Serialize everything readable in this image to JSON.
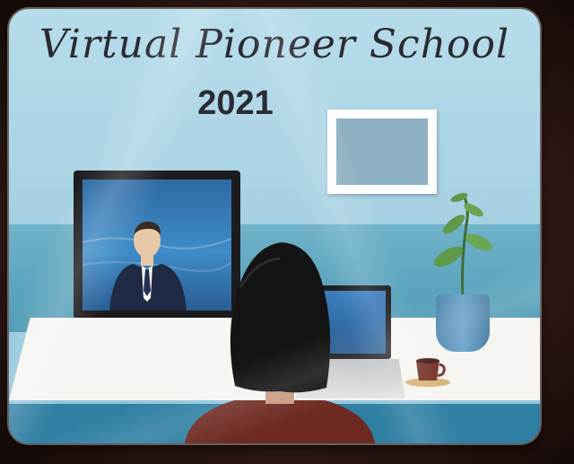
{
  "mousepad": {
    "title": "Virtual Pioneer School",
    "year": "2021"
  },
  "colors": {
    "wall": "#aad3e4",
    "wall_lower": "#4f9bb5",
    "floor": "#2f7fa3",
    "text": "#2b2b33",
    "sweater": "#6e2a22",
    "hair": "#141414",
    "screen": "#3e8cc8"
  }
}
